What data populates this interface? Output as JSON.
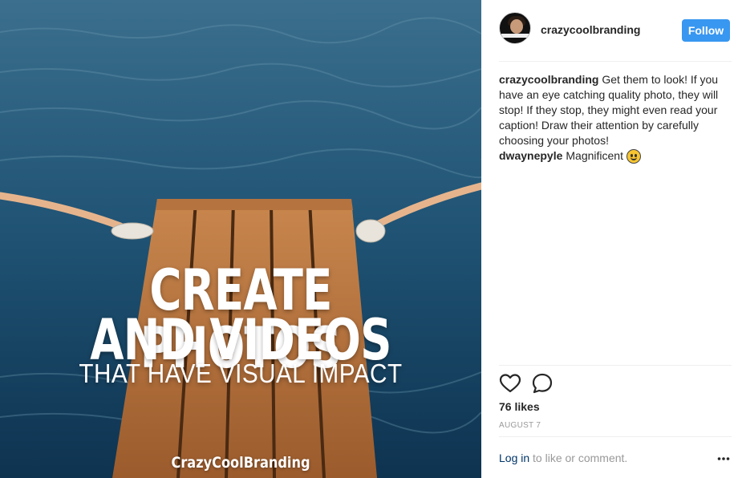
{
  "post": {
    "username": "crazycoolbranding",
    "follow_label": "Follow",
    "caption_user": "crazycoolbranding",
    "caption_text": "Get them to look! If you have an eye catching quality photo, they will stop! If they stop, they might even read your caption! Draw their attention by carefully choosing your photos!",
    "comment_user": "dwaynepyle",
    "comment_text": "Magnificent",
    "comment_emoji": "smiley-emoji",
    "likes": "76 likes",
    "date": "AUGUST 7",
    "login_link": "Log in",
    "login_suffix": "to like or comment."
  },
  "image": {
    "headline_line1": "CREATE PHOTOS",
    "headline_line2": "AND VIDEOS",
    "headline_line3": "THAT HAVE VISUAL IMPACT",
    "brand_mark": "CrazyCoolBranding"
  },
  "icons": {
    "like": "heart-outline-icon",
    "comment": "speech-bubble-icon",
    "more": "more-options-icon"
  },
  "colors": {
    "follow_button": "#3897f0",
    "link": "#003569",
    "muted": "#999999",
    "text": "#262626"
  }
}
